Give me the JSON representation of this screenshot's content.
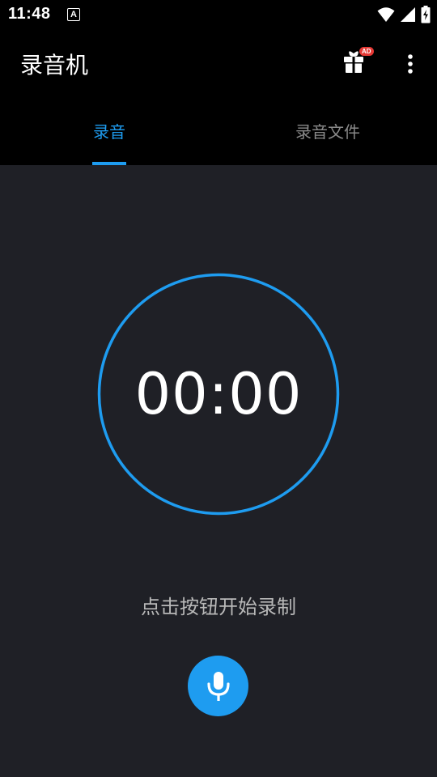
{
  "status_bar": {
    "time": "11:48",
    "notification_icon_letter": "A",
    "icons": [
      "wifi-icon",
      "cellular-signal-icon",
      "battery-charging-icon"
    ]
  },
  "app_bar": {
    "title": "录音机",
    "gift_badge": "AD",
    "icons": [
      "gift-icon",
      "more-vert-icon"
    ]
  },
  "tabs": [
    {
      "label": "录音",
      "active": true
    },
    {
      "label": "录音文件",
      "active": false
    }
  ],
  "recorder": {
    "timer": "00:00",
    "hint": "点击按钮开始录制",
    "record_icon": "microphone-icon"
  },
  "colors": {
    "accent": "#1e9cf0",
    "background": "#1f2026",
    "bar": "#000000",
    "inactive_tab": "#8a8a8a",
    "ad_badge": "#e53935"
  }
}
